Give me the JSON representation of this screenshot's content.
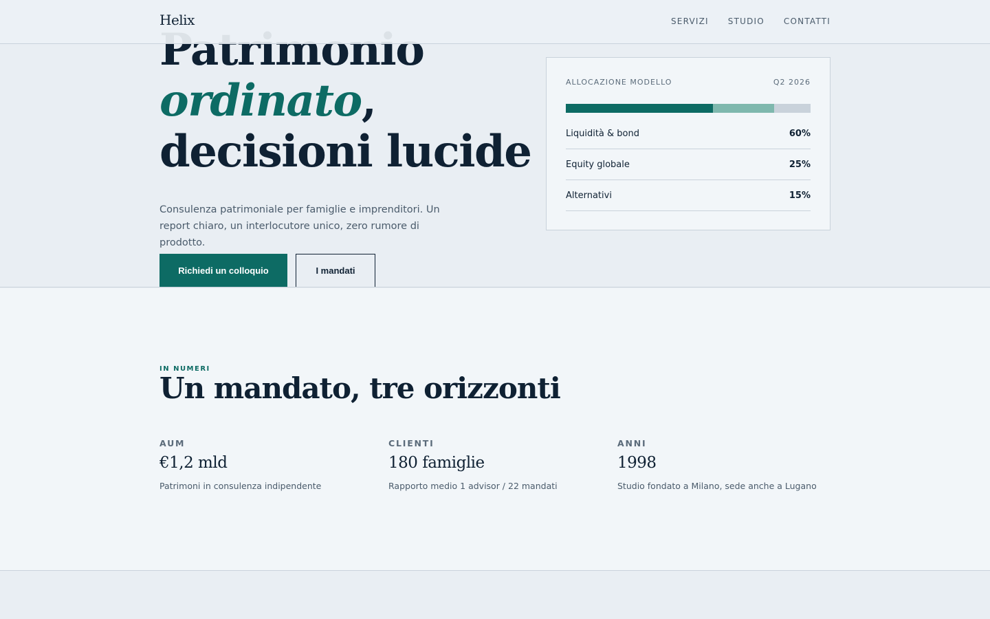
{
  "colors": {
    "accent": "#0d6b64",
    "ink": "#0f2133",
    "accent_light": "#7fb8ae",
    "rail": "#c9d2db"
  },
  "nav": {
    "brand": "Helix",
    "links": [
      {
        "label": "SERVIZI"
      },
      {
        "label": "STUDIO"
      },
      {
        "label": "CONTATTI"
      }
    ]
  },
  "hero": {
    "headline_line1": "Patrimonio",
    "headline_accent": "ordinato",
    "headline_comma": ",",
    "headline_line3": "decisioni lucide",
    "lede": "Consulenza patrimoniale per famiglie e imprenditori. Un report chiaro, un interlocutore unico, zero rumore di prodotto.",
    "primary_cta": "Richiedi un colloquio",
    "secondary_cta": "I mandati"
  },
  "allocation": {
    "title": "ALLOCAZIONE MODELLO",
    "period": "Q2 2026",
    "segments": [
      {
        "label": "Liquidità & bond",
        "percent": 60,
        "display": "60%",
        "color": "#0d6b64"
      },
      {
        "label": "Equity globale",
        "percent": 25,
        "display": "25%",
        "color": "#7fb8ae"
      },
      {
        "label": "Alternativi",
        "percent": 15,
        "display": "15%",
        "color": "#c9d2db"
      }
    ]
  },
  "numbers": {
    "eyebrow": "IN NUMERI",
    "title": "Un mandato, tre orizzonti",
    "stats": [
      {
        "label": "AUM",
        "value": "€1,2 mld",
        "desc": "Patrimoni in consulenza indipendente"
      },
      {
        "label": "CLIENTI",
        "value": "180 famiglie",
        "desc": "Rapporto medio 1 advisor / 22 mandati"
      },
      {
        "label": "ANNI",
        "value": "1998",
        "desc": "Studio fondato a Milano, sede anche a Lugano"
      }
    ]
  }
}
